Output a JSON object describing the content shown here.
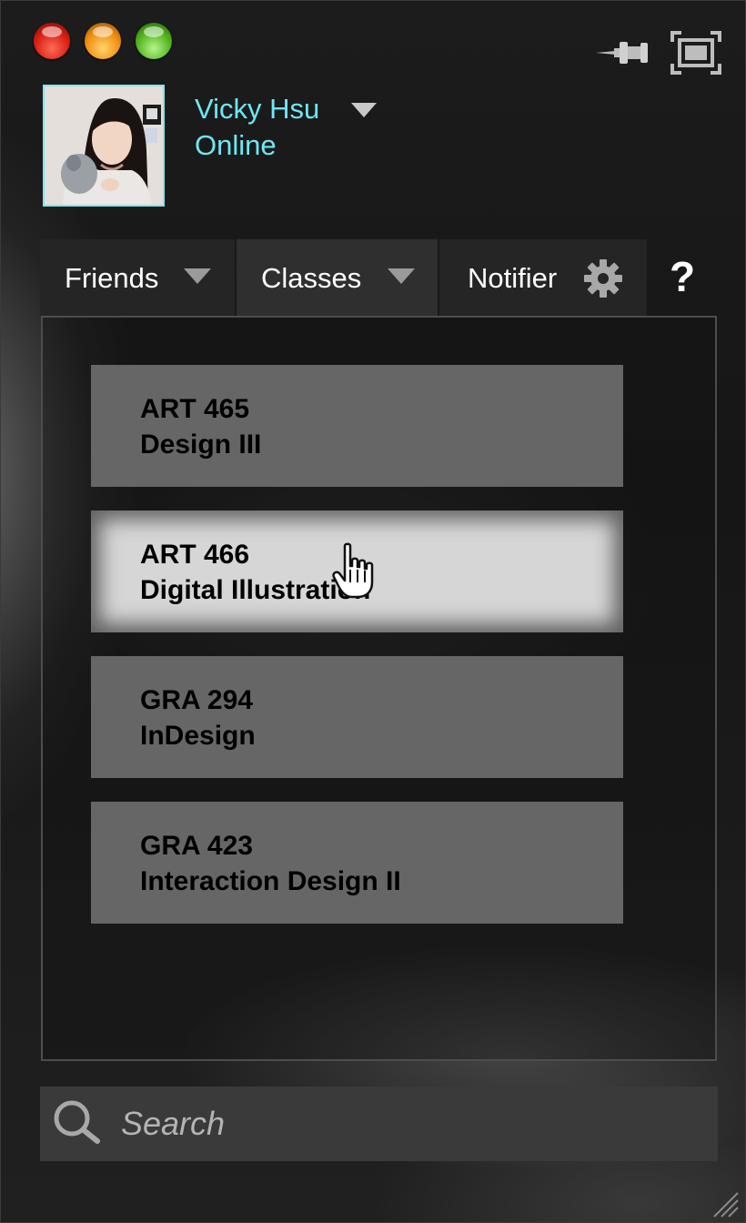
{
  "window": {
    "controls": [
      "close",
      "minimize",
      "maximize"
    ],
    "icons": [
      "pin-icon",
      "fullscreen-icon"
    ]
  },
  "user": {
    "name": "Vicky Hsu",
    "status": "Online",
    "avatar_alt": "Profile photo"
  },
  "tabs": [
    {
      "label": "Friends",
      "has_dropdown": true
    },
    {
      "label": "Classes",
      "has_dropdown": true,
      "active": true
    },
    {
      "label": "Notifier",
      "icon": "gear-icon"
    }
  ],
  "help": {
    "label": "?"
  },
  "classes": [
    {
      "code": "ART 465",
      "title": "Design III"
    },
    {
      "code": "ART 466",
      "title": "Digital Illustration",
      "hovered": true
    },
    {
      "code": "GRA 294",
      "title": "InDesign"
    },
    {
      "code": "GRA 423",
      "title": "Interaction Design II"
    }
  ],
  "search": {
    "placeholder": "Search",
    "value": ""
  },
  "colors": {
    "accent_cyan": "#6fe6f2",
    "card": "#666666",
    "card_hover": "#d6d6d6"
  }
}
